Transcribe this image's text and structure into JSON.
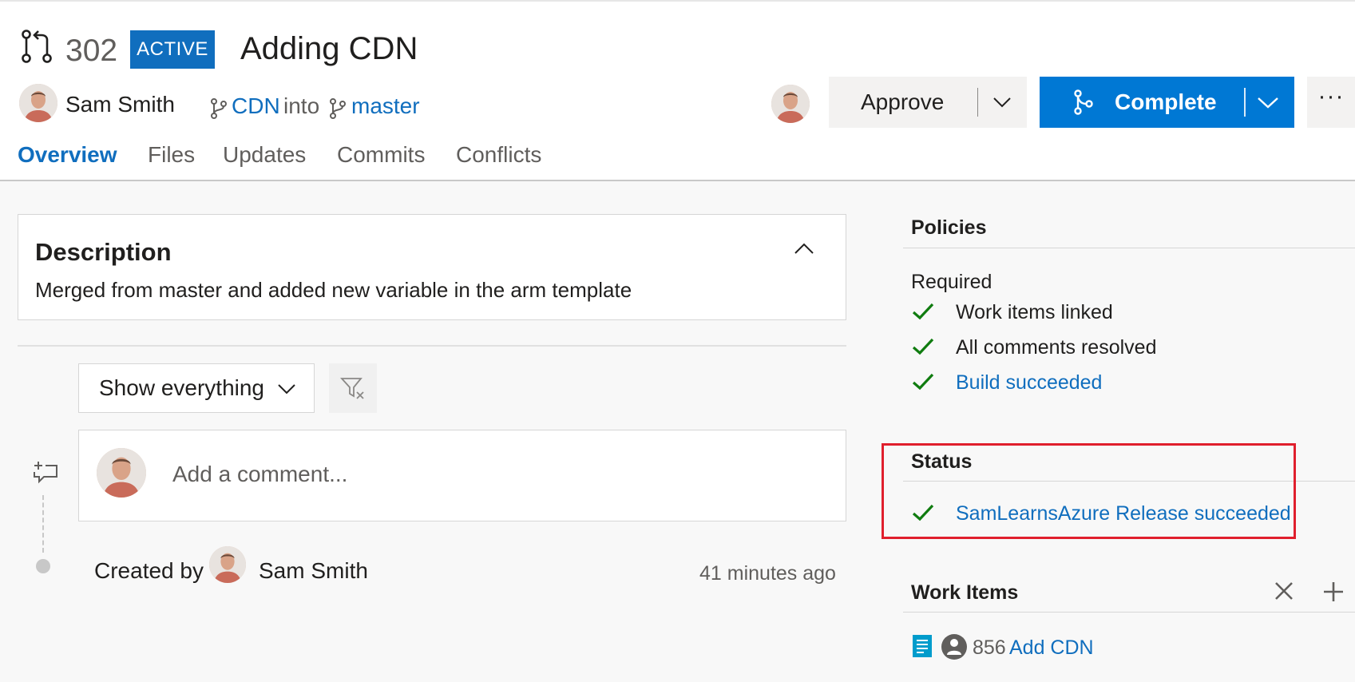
{
  "pull_request": {
    "id": "302",
    "status": "ACTIVE",
    "title": "Adding CDN",
    "author": "Sam Smith",
    "source_branch": "CDN",
    "into_label": "into",
    "target_branch": "master"
  },
  "actions": {
    "approve_label": "Approve",
    "complete_label": "Complete",
    "more_label": "···"
  },
  "tabs": [
    {
      "label": "Overview",
      "active": true
    },
    {
      "label": "Files",
      "active": false
    },
    {
      "label": "Updates",
      "active": false
    },
    {
      "label": "Commits",
      "active": false
    },
    {
      "label": "Conflicts",
      "active": false
    }
  ],
  "description": {
    "heading": "Description",
    "text": "Merged from master and added new variable in the arm template"
  },
  "activity": {
    "filter_selected": "Show everything",
    "comment_placeholder": "Add a comment...",
    "created_by_label": "Created by",
    "created_by_name": "Sam Smith",
    "created_time": "41 minutes ago"
  },
  "policies": {
    "heading": "Policies",
    "required_label": "Required",
    "items": [
      {
        "label": "Work items linked",
        "is_link": false
      },
      {
        "label": "All comments resolved",
        "is_link": false
      },
      {
        "label": "Build succeeded",
        "is_link": true
      }
    ]
  },
  "status": {
    "heading": "Status",
    "items": [
      {
        "label": "SamLearnsAzure Release succeeded",
        "is_link": true
      }
    ]
  },
  "work_items": {
    "heading": "Work Items",
    "items": [
      {
        "id": "856",
        "title": "Add CDN"
      }
    ]
  },
  "colors": {
    "accent": "#0078d4",
    "link": "#106ebe",
    "success": "#107c10",
    "highlight": "#e01f2d"
  }
}
